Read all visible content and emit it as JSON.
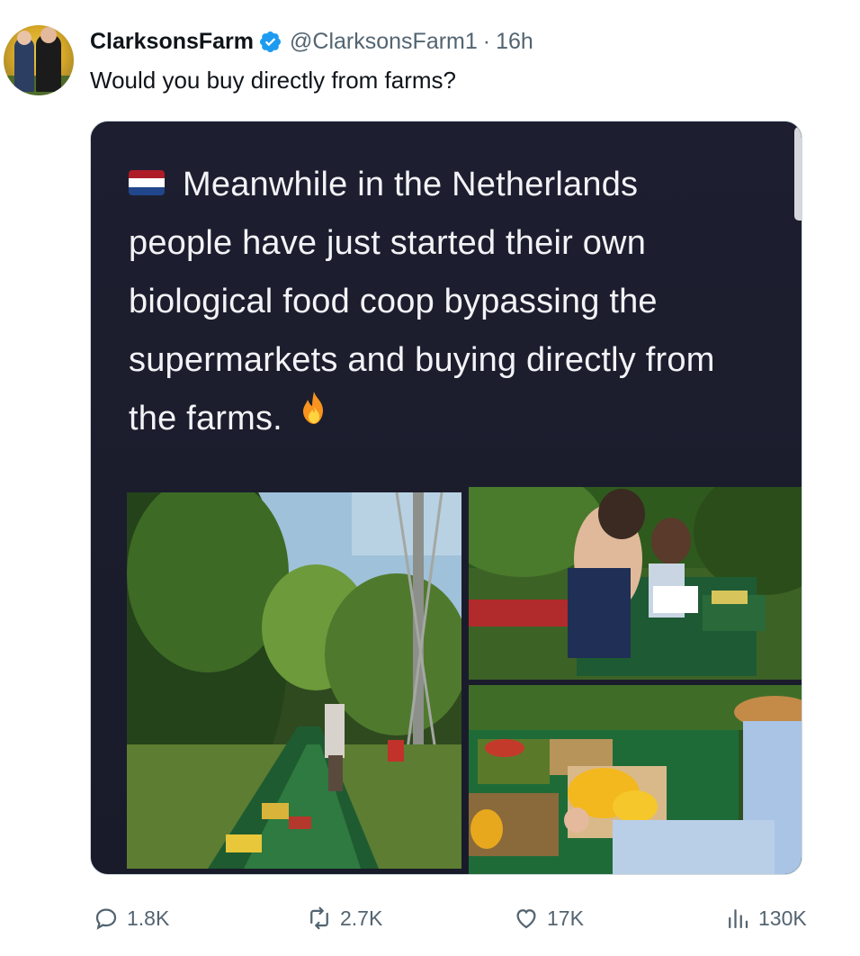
{
  "tweet": {
    "author_name": "ClarksonsFarm",
    "handle": "@ClarksonsFarm1",
    "separator": "·",
    "time": "16h",
    "text": "Would you buy directly from farms?",
    "verified": true
  },
  "media": {
    "caption_lines": [
      "Meanwhile in the Netherlands",
      "people have just started their own",
      "biological food coop bypassing the",
      "supermarkets and buying directly from",
      "the farms."
    ],
    "flag_icon": "netherlands-flag-icon",
    "emoji_icon": "fire-icon"
  },
  "actions": {
    "replies": "1.8K",
    "retweets": "2.7K",
    "likes": "17K",
    "views": "130K"
  },
  "colors": {
    "verified_blue": "#1d9bf0",
    "secondary_text": "#536471",
    "media_background": "#1d1f30"
  }
}
